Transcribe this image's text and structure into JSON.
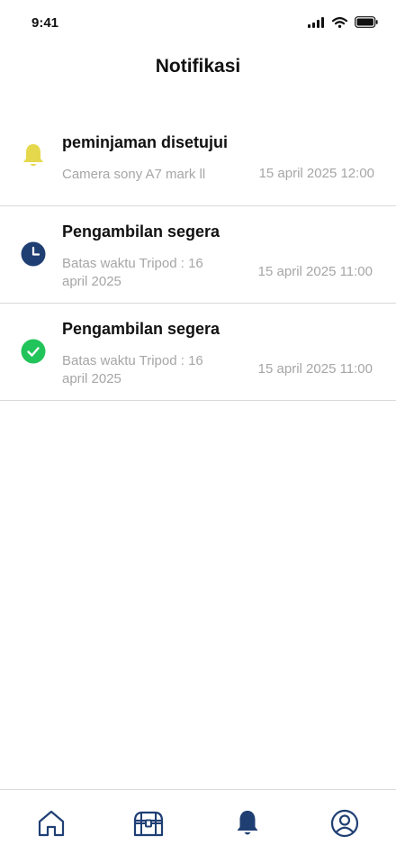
{
  "status_bar": {
    "time": "9:41",
    "icons": [
      "signal-icon",
      "wifi-icon",
      "battery-icon"
    ]
  },
  "header": {
    "title": "Notifikasi"
  },
  "notifications": [
    {
      "icon": "bell-icon",
      "icon_color": "#E5D84D",
      "title": "peminjaman disetujui",
      "description": "Camera sony A7 mark ll",
      "time": "15 april 2025 12:00"
    },
    {
      "icon": "clock-icon",
      "icon_color": "#1F3F73",
      "title": "Pengambilan segera",
      "description": "Batas waktu Tripod : 16 april 2025",
      "time": "15 april 2025 11:00"
    },
    {
      "icon": "check-circle-icon",
      "icon_color": "#21C45A",
      "title": "Pengambilan segera",
      "description": "Batas waktu Tripod : 16 april 2025",
      "time": "15 april 2025 11:00"
    }
  ],
  "bottom_nav": {
    "active": "notifications",
    "items": [
      "home-icon",
      "chest-icon",
      "bell-icon",
      "profile-icon"
    ],
    "color": "#1F3F73"
  }
}
